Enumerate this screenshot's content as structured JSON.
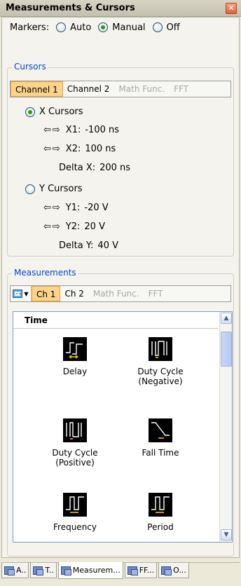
{
  "window": {
    "title": "Measurements & Cursors",
    "close_glyph": "✕"
  },
  "markers": {
    "label": "Markers:",
    "options": [
      {
        "label": "Auto",
        "checked": false
      },
      {
        "label": "Manual",
        "checked": true
      },
      {
        "label": "Off",
        "checked": false
      }
    ]
  },
  "cursors": {
    "legend": "Cursors",
    "tabs": [
      {
        "label": "Channel 1",
        "state": "active"
      },
      {
        "label": "Channel 2",
        "state": "normal"
      },
      {
        "label": "Math Func.",
        "state": "disabled"
      },
      {
        "label": "FFT",
        "state": "disabled"
      }
    ],
    "x": {
      "label": "X Cursors",
      "checked": true,
      "x1_label": "X1:",
      "x1_value": "-100 ns",
      "x2_label": "X2:",
      "x2_value": "100 ns",
      "delta_label": "Delta X:",
      "delta_value": "200 ns"
    },
    "y": {
      "label": "Y Cursors",
      "checked": false,
      "y1_label": "Y1:",
      "y1_value": "-20 V",
      "y2_label": "Y2:",
      "y2_value": "20 V",
      "delta_label": "Delta Y:",
      "delta_value": "40 V"
    },
    "arrows_glyph": "⇦⇨"
  },
  "measurements": {
    "legend": "Measurements",
    "tabs": [
      {
        "label": "Ch 1",
        "state": "active"
      },
      {
        "label": "Ch 2",
        "state": "normal"
      },
      {
        "label": "Math Func.",
        "state": "disabled"
      },
      {
        "label": "FFT",
        "state": "disabled"
      }
    ],
    "list_header": "Time",
    "items": [
      {
        "label": "Delay",
        "icon": "delay-icon"
      },
      {
        "label": "Duty Cycle\n(Negative)",
        "icon": "duty-cycle-negative-icon"
      },
      {
        "label": "Duty Cycle\n(Positive)",
        "icon": "duty-cycle-positive-icon"
      },
      {
        "label": "Fall Time",
        "icon": "fall-time-icon"
      },
      {
        "label": "Frequency",
        "icon": "frequency-icon"
      },
      {
        "label": "Period",
        "icon": "period-icon"
      }
    ]
  },
  "bottom_tabs": [
    {
      "label": "A..",
      "active": false
    },
    {
      "label": "T..",
      "active": false
    },
    {
      "label": "Measurem...",
      "active": true
    },
    {
      "label": "FF...",
      "active": false
    },
    {
      "label": "O...",
      "active": false
    }
  ]
}
